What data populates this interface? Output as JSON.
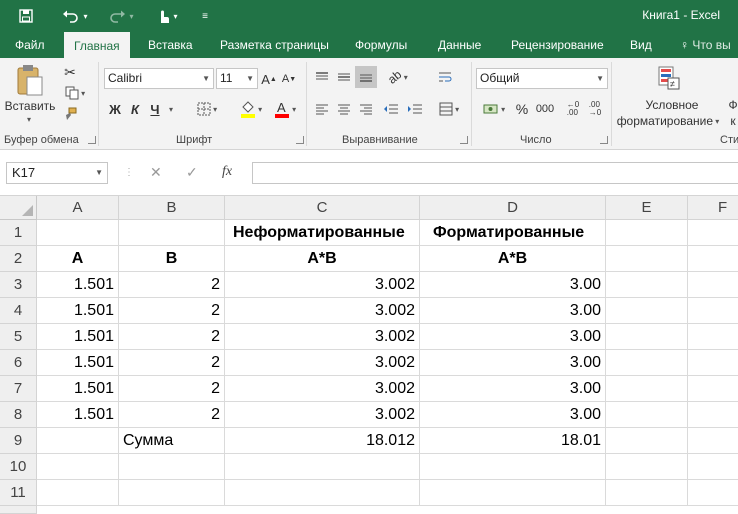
{
  "window": {
    "title": "Книга1 - Excel"
  },
  "ribbon_tabs": [
    "Файл",
    "Главная",
    "Вставка",
    "Разметка страницы",
    "Формулы",
    "Данные",
    "Рецензирование",
    "Вид",
    "Что вы"
  ],
  "ribbon": {
    "paste_label": "Вставить",
    "clipboard_label": "Буфер обмена",
    "font_name": "Calibri",
    "font_size": "11",
    "bold": "Ж",
    "italic": "К",
    "underline": "Ч",
    "font_group_label": "Шрифт",
    "alignment_group_label": "Выравнивание",
    "number_format": "Общий",
    "percent": "%",
    "thousands": "000",
    "number_group_label": "Число",
    "cond_format_line1": "Условное",
    "cond_format_line2": "форматирование",
    "styles_group_partial": "Сти",
    "partial_btn_1": "Ф",
    "partial_btn_2": "к"
  },
  "formula_bar": {
    "name_box": "K17",
    "fx": "fx",
    "content": ""
  },
  "columns": [
    "A",
    "B",
    "C",
    "D",
    "E",
    "F"
  ],
  "rows": [
    "1",
    "2",
    "3",
    "4",
    "5",
    "6",
    "7",
    "8",
    "9",
    "10",
    "11"
  ],
  "cells": {
    "C1": "Неформатированные",
    "D1": "Форматированные",
    "A2": "A",
    "B2": "B",
    "C2": "A*B",
    "D2": "A*B",
    "A3": "1.501",
    "B3": "2",
    "C3": "3.002",
    "D3": "3.00",
    "A4": "1.501",
    "B4": "2",
    "C4": "3.002",
    "D4": "3.00",
    "A5": "1.501",
    "B5": "2",
    "C5": "3.002",
    "D5": "3.00",
    "A6": "1.501",
    "B6": "2",
    "C6": "3.002",
    "D6": "3.00",
    "A7": "1.501",
    "B7": "2",
    "C7": "3.002",
    "D7": "3.00",
    "A8": "1.501",
    "B8": "2",
    "C8": "3.002",
    "D8": "3.00",
    "B9": "Сумма",
    "C9": "18.012",
    "D9": "18.01"
  },
  "colors": {
    "excel_green": "#217346",
    "highlight": "#ffff00",
    "font_color": "#ff0000"
  }
}
